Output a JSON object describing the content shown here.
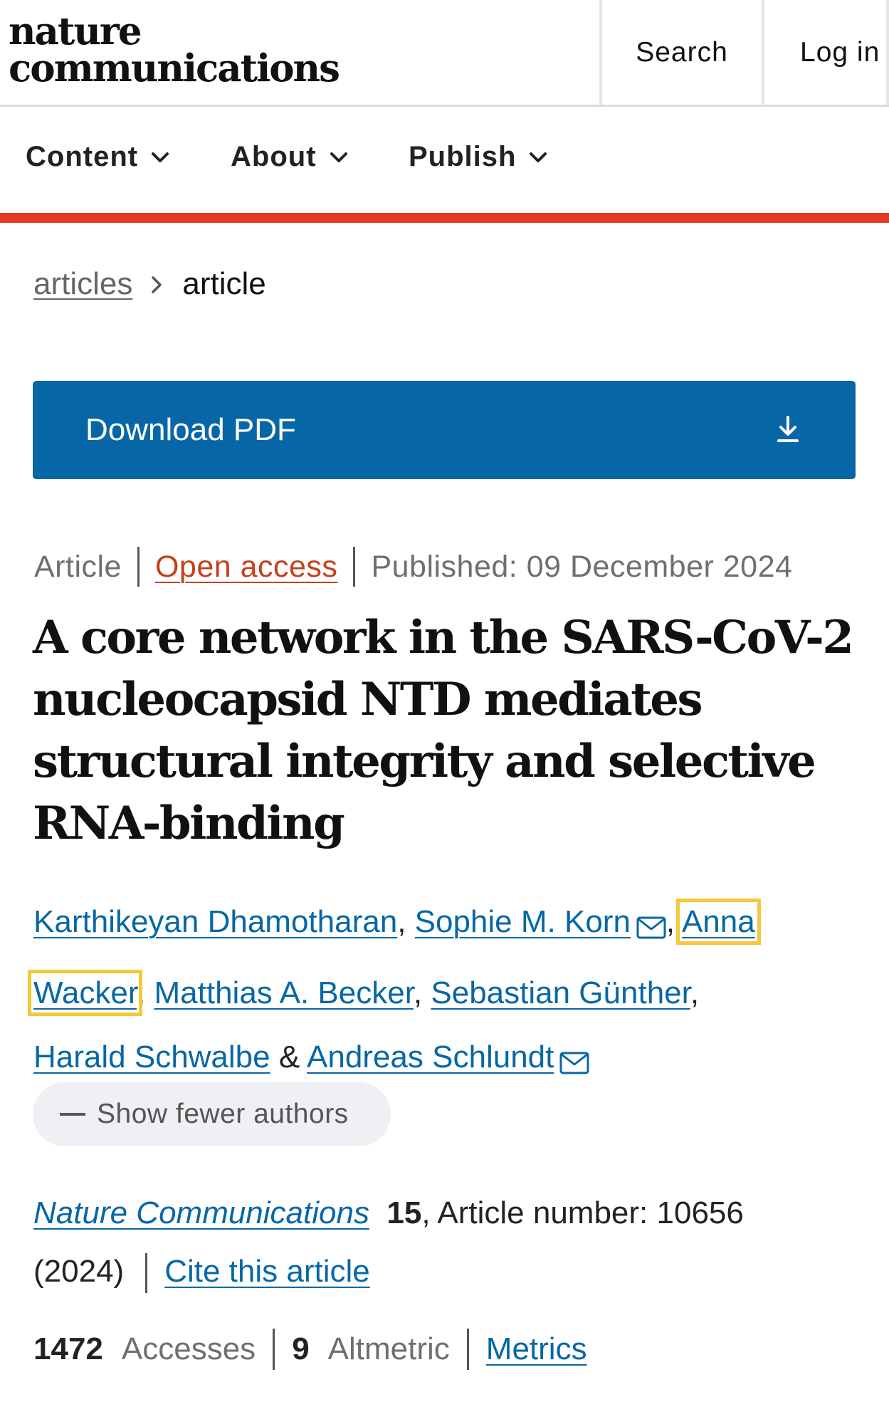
{
  "header": {
    "logo_line1": "nature",
    "logo_line2": "communications",
    "search_label": "Search",
    "login_label": "Log in"
  },
  "nav": {
    "items": [
      {
        "label": "Content",
        "icon": "chevron-down-icon"
      },
      {
        "label": "About",
        "icon": "chevron-down-icon"
      },
      {
        "label": "Publish",
        "icon": "chevron-down-icon"
      }
    ]
  },
  "breadcrumb": {
    "parent": "articles",
    "current": "article"
  },
  "download": {
    "label": "Download PDF",
    "icon": "download-icon"
  },
  "meta": {
    "type": "Article",
    "access": "Open access",
    "published": "Published: 09 December 2024"
  },
  "title": "A core network in the SARS-CoV-2 nucleocapsid NTD mediates structural integrity and selective RNA-binding",
  "authors": {
    "list": [
      "Karthikeyan Dhamotharan",
      "Sophie M. Korn",
      "Anna",
      "Wacker",
      "Matthias A. Becker",
      "Sebastian Günther",
      "Harald Schwalbe",
      "Andreas Schlundt"
    ],
    "separator_amp": "&",
    "show_fewer_label": "Show fewer authors"
  },
  "citation": {
    "journal": "Nature Communications",
    "volume": "15",
    "article_number": ", Article number: 10656",
    "year": "(2024)",
    "cite_label": "Cite this article"
  },
  "metrics": {
    "accesses_count": "1472",
    "accesses_label": "Accesses",
    "altmetric_count": "9",
    "altmetric_label": "Altmetric",
    "metrics_link": "Metrics"
  },
  "colors": {
    "accent_blue": "#0767a6",
    "brand_red": "#e23a25",
    "open_access_orange": "#c4401b",
    "highlight_yellow": "#f5c83c"
  }
}
